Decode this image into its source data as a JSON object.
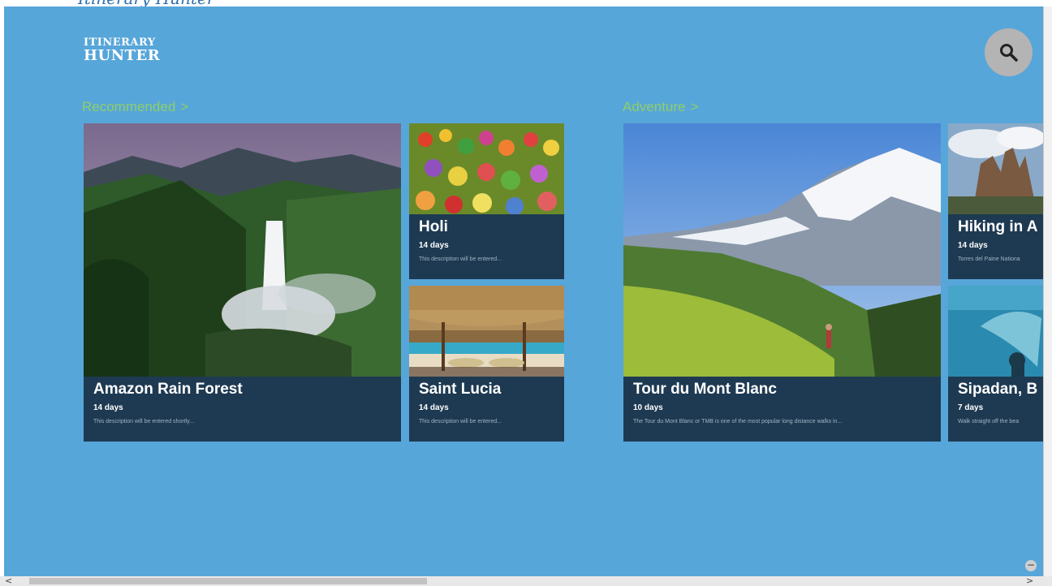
{
  "window": {
    "top_text": "Itinerary Hunter"
  },
  "header": {
    "logo_line1": "ITINERARY",
    "logo_line2": "HUNTER",
    "search_icon": "search-icon"
  },
  "sections": [
    {
      "title": "Recommended",
      "chevron": ">"
    },
    {
      "title": "Adventure",
      "chevron": ">"
    }
  ],
  "tiles": {
    "amazon": {
      "title": "Amazon Rain Forest",
      "duration": "14 days",
      "description": "This description will be entered shortly..."
    },
    "holi": {
      "title": "Holi",
      "duration": "14 days",
      "description": "This description will be entered..."
    },
    "saint_lucia": {
      "title": "Saint Lucia",
      "duration": "14 days",
      "description": "This description will be entered..."
    },
    "mont_blanc": {
      "title": "Tour du Mont Blanc",
      "duration": "10 days",
      "description": "The Tour du Mont Blanc or TMB is one of the most popular long distance walks in..."
    },
    "hiking": {
      "title": "Hiking in A",
      "duration": "14 days",
      "description": "Torres del Paine Nationa"
    },
    "sipadan": {
      "title": "Sipadan, B",
      "duration": "7 days",
      "description": "Walk straight off the bea"
    }
  },
  "scrollbar": {
    "left_arrow": "<",
    "right_arrow": ">"
  },
  "minus_button": "−",
  "colors": {
    "background": "#57a6d9",
    "tile_caption": "#1e3a52",
    "section_title": "#8fce6a"
  }
}
